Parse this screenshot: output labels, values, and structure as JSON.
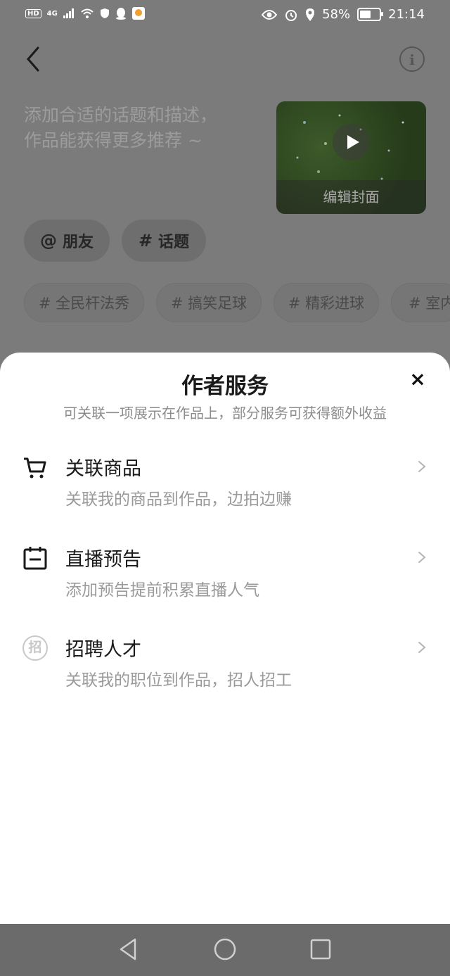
{
  "status_bar": {
    "hd": "HD",
    "network": "4G",
    "battery": "58%",
    "time": "21:14"
  },
  "editor": {
    "description_placeholder_line1": "添加合适的话题和描述，",
    "description_placeholder_line2": "作品能获得更多推荐 ~",
    "cover_edit_label": "编辑封面",
    "mention_chip_symbol": "@",
    "mention_chip_label": "朋友",
    "topic_chip_symbol": "#",
    "topic_chip_label": "话题",
    "suggested_topics": [
      "# 全民杆法秀",
      "# 搞笑足球",
      "# 精彩进球",
      "# 室内"
    ]
  },
  "sheet": {
    "title": "作者服务",
    "subtitle": "可关联一项展示在作品上，部分服务可获得额外收益",
    "close_glyph": "×",
    "items": [
      {
        "title": "关联商品",
        "desc": "关联我的商品到作品，边拍边赚",
        "icon": "cart-icon"
      },
      {
        "title": "直播预告",
        "desc": "添加预告提前积累直播人气",
        "icon": "calendar-icon"
      },
      {
        "title": "招聘人才",
        "desc": "关联我的职位到作品，招人招工",
        "icon": "recruit-icon",
        "icon_text": "招"
      }
    ]
  },
  "colors": {
    "overlay_background": "#7b7b7b",
    "sheet_background": "#ffffff",
    "title_text": "#1a1a1a",
    "secondary_text": "#9a9a9a"
  }
}
